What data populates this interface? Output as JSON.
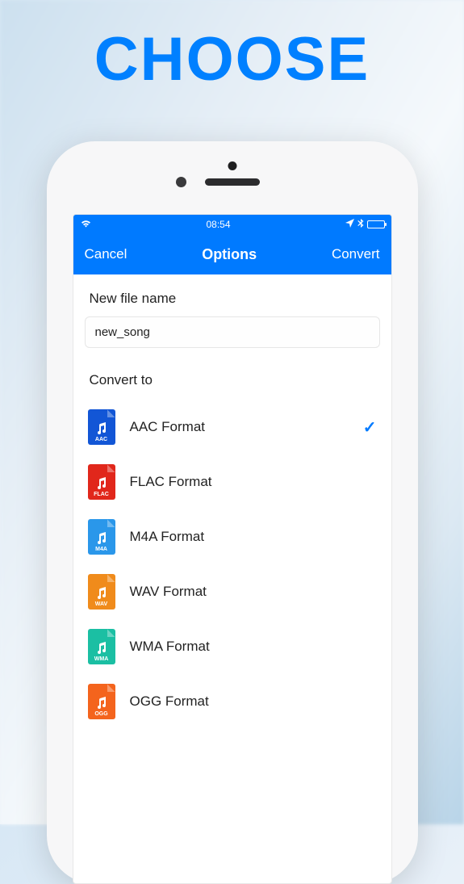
{
  "hero": {
    "title": "CHOOSE"
  },
  "statusbar": {
    "time": "08:54"
  },
  "navbar": {
    "cancel": "Cancel",
    "title": "Options",
    "convert": "Convert"
  },
  "filename": {
    "label": "New file name",
    "value": "new_song"
  },
  "convert": {
    "label": "Convert to"
  },
  "formats": [
    {
      "ext": "AAC",
      "label": "AAC Format",
      "color": "#1256d6",
      "selected": true
    },
    {
      "ext": "FLAC",
      "label": "FLAC Format",
      "color": "#e1271b",
      "selected": false
    },
    {
      "ext": "M4A",
      "label": "M4A Format",
      "color": "#2a97ea",
      "selected": false
    },
    {
      "ext": "WAV",
      "label": "WAV Format",
      "color": "#f08b1b",
      "selected": false
    },
    {
      "ext": "WMA",
      "label": "WMA Format",
      "color": "#1bbfa3",
      "selected": false
    },
    {
      "ext": "OGG",
      "label": "OGG Format",
      "color": "#f4641d",
      "selected": false
    }
  ]
}
